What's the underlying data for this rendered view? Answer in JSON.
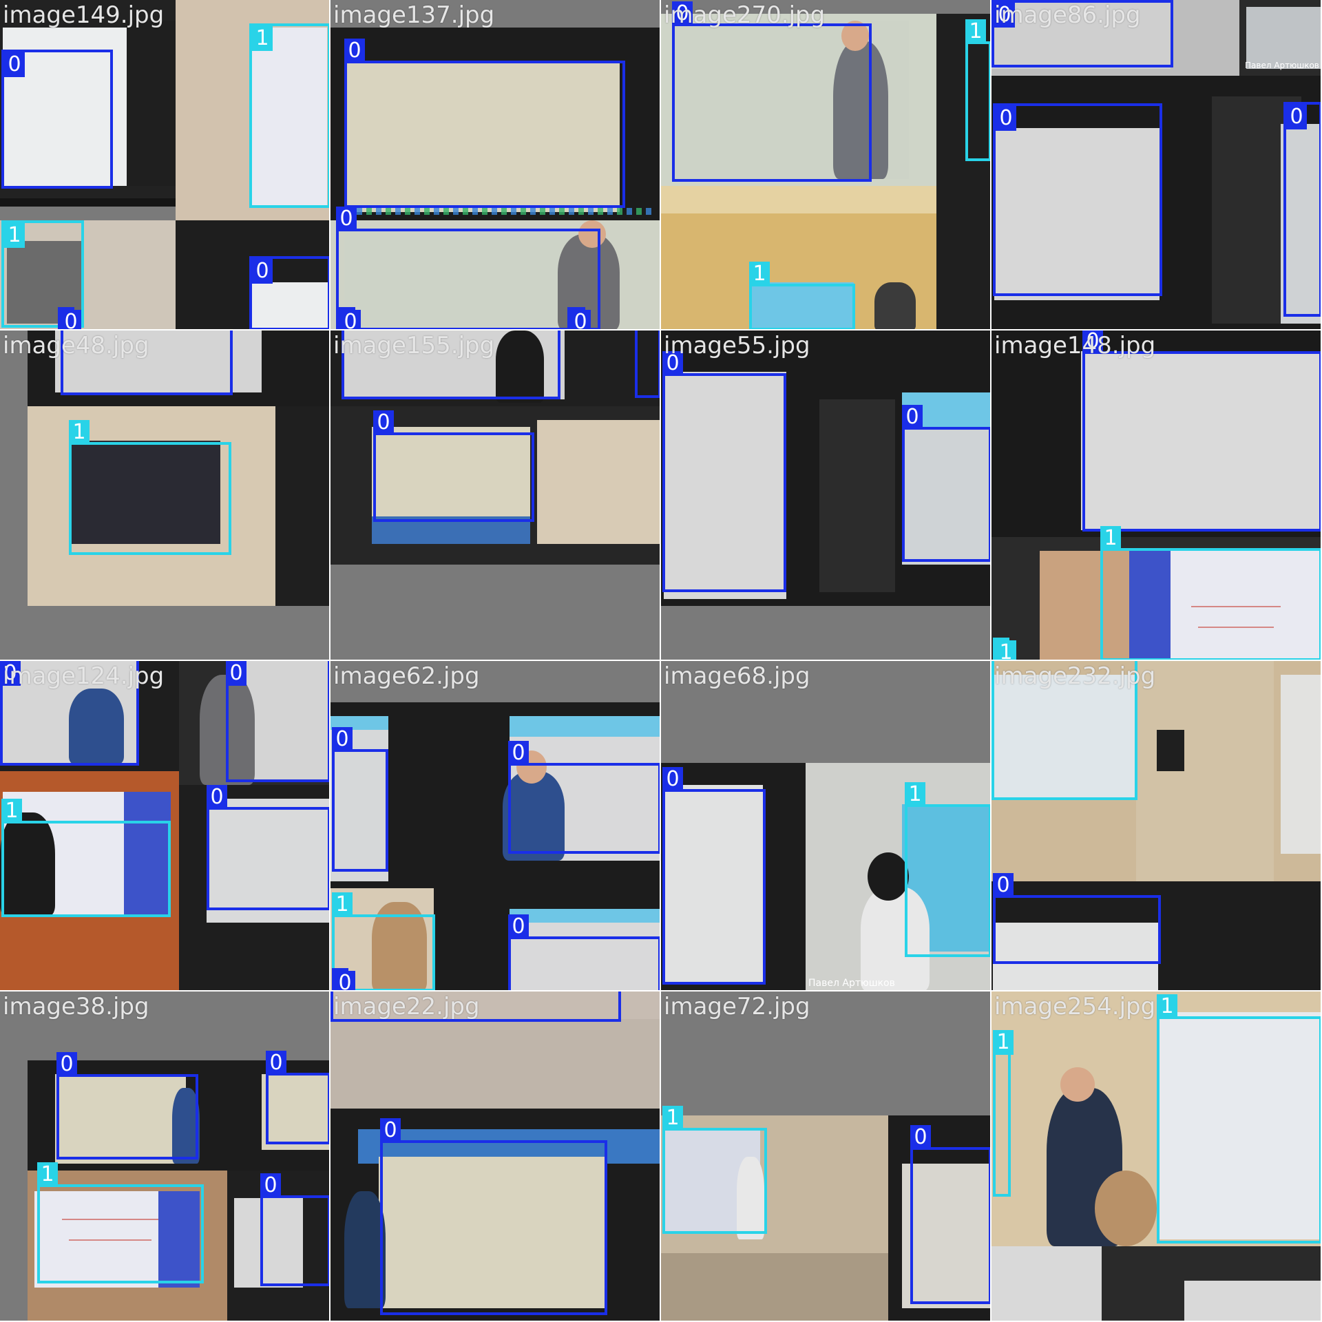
{
  "colors": {
    "class_0": "#1a2ee8",
    "class_1": "#29d3e8",
    "title": "#e6e6e6"
  },
  "tiles": [
    {
      "title": "image149.jpg",
      "labels": [
        "0",
        "1",
        "1",
        "0",
        "0"
      ]
    },
    {
      "title": "image137.jpg",
      "labels": [
        "0",
        "0",
        "0",
        "0"
      ]
    },
    {
      "title": "image270.jpg",
      "labels": [
        "0",
        "1",
        "1"
      ]
    },
    {
      "title": "image86.jpg",
      "labels": [
        "0",
        "0",
        "0"
      ],
      "overlay_text": "Павел Артюшков"
    },
    {
      "title": "image48.jpg",
      "labels": [
        "1"
      ]
    },
    {
      "title": "image155.jpg",
      "labels": [
        "0"
      ]
    },
    {
      "title": "image55.jpg",
      "labels": [
        "0",
        "0"
      ]
    },
    {
      "title": "image148.jpg",
      "labels": [
        "0",
        "1",
        "1"
      ]
    },
    {
      "title": "image124.jpg",
      "labels": [
        "0",
        "0",
        "1",
        "0"
      ]
    },
    {
      "title": "image62.jpg",
      "labels": [
        "0",
        "0",
        "1",
        "0",
        "0"
      ]
    },
    {
      "title": "image68.jpg",
      "labels": [
        "0",
        "1"
      ],
      "overlay_text": "Павел Артюшков"
    },
    {
      "title": "image232.jpg",
      "labels": [
        "0"
      ]
    },
    {
      "title": "image38.jpg",
      "labels": [
        "0",
        "0",
        "1",
        "0"
      ]
    },
    {
      "title": "image22.jpg",
      "labels": [
        "0"
      ]
    },
    {
      "title": "image72.jpg",
      "labels": [
        "1",
        "0"
      ]
    },
    {
      "title": "image254.jpg",
      "labels": [
        "1",
        "1"
      ]
    }
  ]
}
